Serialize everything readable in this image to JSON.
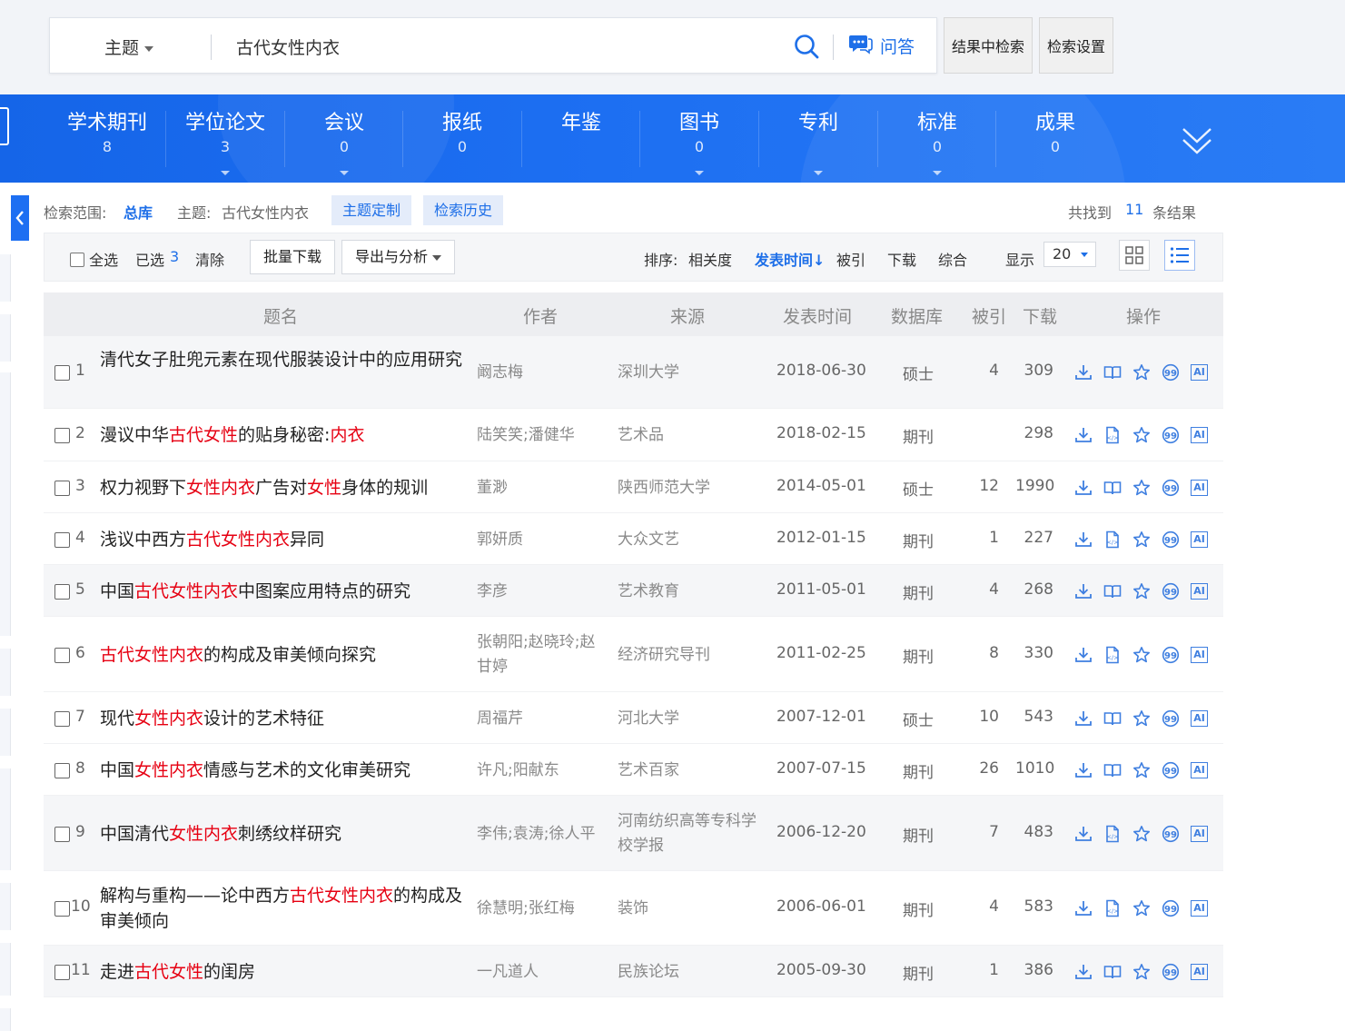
{
  "search": {
    "field": "主题",
    "query": "古代女性内衣",
    "qa_label": "问答",
    "in_results_label": "结果中检索",
    "settings_label": "检索设置"
  },
  "nav": [
    {
      "label": "学术期刊",
      "count": "8"
    },
    {
      "label": "学位论文",
      "count": "3"
    },
    {
      "label": "会议",
      "count": "0"
    },
    {
      "label": "报纸",
      "count": "0"
    },
    {
      "label": "年鉴",
      "count": ""
    },
    {
      "label": "图书",
      "count": "0"
    },
    {
      "label": "专利",
      "count": ""
    },
    {
      "label": "标准",
      "count": "0"
    },
    {
      "label": "成果",
      "count": "0"
    }
  ],
  "scope": {
    "label": "检索范围:",
    "value": "总库",
    "topic_label": "主题:",
    "topic_value": "古代女性内衣",
    "custom_label": "主题定制",
    "history_label": "检索历史",
    "found_prefix": "共找到",
    "found_count": "11",
    "found_suffix": "条结果"
  },
  "toolbar": {
    "select_all": "全选",
    "selected_label": "已选",
    "selected_count": "3",
    "clear": "清除",
    "batch_download": "批量下载",
    "export": "导出与分析",
    "sort_label": "排序:",
    "sort_relevance": "相关度",
    "sort_date": "发表时间",
    "sort_cited": "被引",
    "sort_download": "下载",
    "sort_overall": "综合",
    "display_label": "显示",
    "page_size": "20"
  },
  "table": {
    "headers": {
      "title": "题名",
      "author": "作者",
      "source": "来源",
      "date": "发表时间",
      "db": "数据库",
      "cite": "被引",
      "download": "下载",
      "ops": "操作"
    },
    "rows": [
      {
        "no": "1",
        "title": [
          {
            "t": "清代女子肚兜元素在现代服装设计中的应用研究",
            "h": false
          }
        ],
        "author": "阚志梅",
        "source": "深圳大学",
        "date": "2018-06-30",
        "db": "硕士",
        "cite": "4",
        "download": "309"
      },
      {
        "no": "2",
        "title": [
          {
            "t": "漫议中华",
            "h": false
          },
          {
            "t": "古代女性",
            "h": true
          },
          {
            "t": "的贴身秘密:",
            "h": false
          },
          {
            "t": "内衣",
            "h": true
          }
        ],
        "author": "陆笑笑;潘健华",
        "source": "艺术品",
        "date": "2018-02-15",
        "db": "期刊",
        "cite": "",
        "download": "298"
      },
      {
        "no": "3",
        "title": [
          {
            "t": "权力视野下",
            "h": false
          },
          {
            "t": "女性内衣",
            "h": true
          },
          {
            "t": "广告对",
            "h": false
          },
          {
            "t": "女性",
            "h": true
          },
          {
            "t": "身体的规训",
            "h": false
          }
        ],
        "author": "董渺",
        "source": "陕西师范大学",
        "date": "2014-05-01",
        "db": "硕士",
        "cite": "12",
        "download": "1990"
      },
      {
        "no": "4",
        "title": [
          {
            "t": "浅议中西方",
            "h": false
          },
          {
            "t": "古代女性内衣",
            "h": true
          },
          {
            "t": "异同",
            "h": false
          }
        ],
        "author": "郭妍质",
        "source": "大众文艺",
        "date": "2012-01-15",
        "db": "期刊",
        "cite": "1",
        "download": "227"
      },
      {
        "no": "5",
        "title": [
          {
            "t": "中国",
            "h": false
          },
          {
            "t": "古代女性内衣",
            "h": true
          },
          {
            "t": "中图案应用特点的研究",
            "h": false
          }
        ],
        "author": "李彦",
        "source": "艺术教育",
        "date": "2011-05-01",
        "db": "期刊",
        "cite": "4",
        "download": "268"
      },
      {
        "no": "6",
        "title": [
          {
            "t": "古代女性内衣",
            "h": true
          },
          {
            "t": "的构成及审美倾向探究",
            "h": false
          }
        ],
        "author": "张朝阳;赵晓玲;赵甘婷",
        "source": "经济研究导刊",
        "date": "2011-02-25",
        "db": "期刊",
        "cite": "8",
        "download": "330"
      },
      {
        "no": "7",
        "title": [
          {
            "t": "现代",
            "h": false
          },
          {
            "t": "女性内衣",
            "h": true
          },
          {
            "t": "设计的艺术特征",
            "h": false
          }
        ],
        "author": "周福芹",
        "source": "河北大学",
        "date": "2007-12-01",
        "db": "硕士",
        "cite": "10",
        "download": "543"
      },
      {
        "no": "8",
        "title": [
          {
            "t": "中国",
            "h": false
          },
          {
            "t": "女性内衣",
            "h": true
          },
          {
            "t": "情感与艺术的文化审美研究",
            "h": false
          }
        ],
        "author": "许凡;阳献东",
        "source": "艺术百家",
        "date": "2007-07-15",
        "db": "期刊",
        "cite": "26",
        "download": "1010"
      },
      {
        "no": "9",
        "title": [
          {
            "t": "中国清代",
            "h": false
          },
          {
            "t": "女性内衣",
            "h": true
          },
          {
            "t": "刺绣纹样研究",
            "h": false
          }
        ],
        "author": "李伟;袁涛;徐人平",
        "source": "河南纺织高等专科学校学报",
        "date": "2006-12-20",
        "db": "期刊",
        "cite": "7",
        "download": "483"
      },
      {
        "no": "10",
        "title": [
          {
            "t": "解构与重构——论中西方",
            "h": false
          },
          {
            "t": "古代女性内衣",
            "h": true
          },
          {
            "t": "的构成及审美倾向",
            "h": false
          }
        ],
        "author": "徐慧明;张红梅",
        "source": "装饰",
        "date": "2006-06-01",
        "db": "期刊",
        "cite": "4",
        "download": "583"
      },
      {
        "no": "11",
        "title": [
          {
            "t": "走进",
            "h": false
          },
          {
            "t": "古代女性",
            "h": true
          },
          {
            "t": "的闺房",
            "h": false
          }
        ],
        "author": "一凡道人",
        "source": "民族论坛",
        "date": "2005-09-30",
        "db": "期刊",
        "cite": "1",
        "download": "386"
      }
    ]
  },
  "colors": {
    "accent": "#1e6fe8",
    "nav_bg": "#1d6ff2",
    "highlight": "#e60012"
  }
}
